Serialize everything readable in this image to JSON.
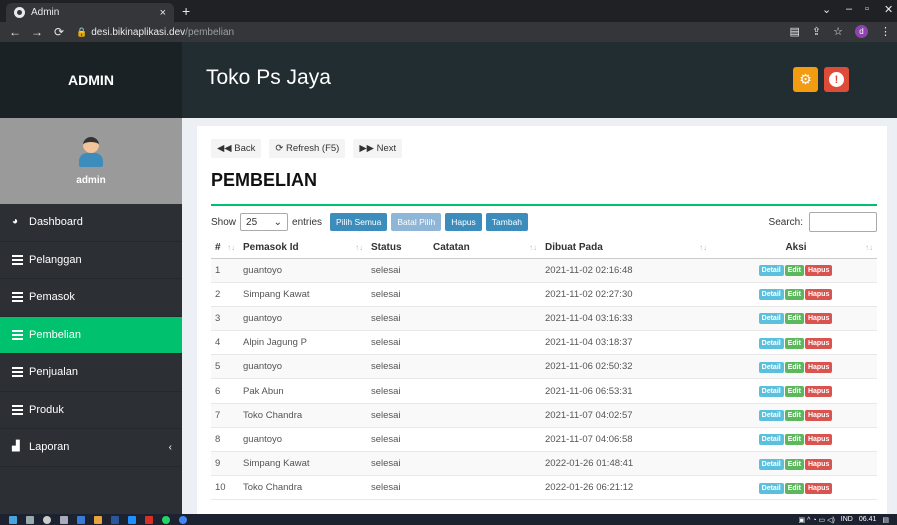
{
  "browser": {
    "tab_title": "Admin",
    "tab_close": "×",
    "new_tab": "+",
    "url_domain": "desi.bikinaplikasi.dev",
    "url_path": "/pembelian"
  },
  "header": {
    "logo": "ADMIN",
    "title": "Toko Ps Jaya"
  },
  "sidebar": {
    "user_name": "admin",
    "items": [
      {
        "label": "Dashboard",
        "icon": "dashboard-icon"
      },
      {
        "label": "Pelanggan",
        "icon": "table-icon"
      },
      {
        "label": "Pemasok",
        "icon": "table-icon"
      },
      {
        "label": "Pembelian",
        "icon": "table-icon",
        "active": true
      },
      {
        "label": "Penjualan",
        "icon": "table-icon"
      },
      {
        "label": "Produk",
        "icon": "table-icon"
      },
      {
        "label": "Laporan",
        "icon": "chart-icon"
      }
    ]
  },
  "toolbar": {
    "back": "Back",
    "refresh": "Refresh (F5)",
    "next": "Next"
  },
  "page_title": "PEMBELIAN",
  "controls": {
    "show_label": "Show",
    "entries_value": "25",
    "entries_label": "entries",
    "pilih_semua": "Pilih Semua",
    "batal_pilih": "Batal Pilih",
    "hapus": "Hapus",
    "tambah": "Tambah",
    "search_label": "Search:"
  },
  "table": {
    "headers": [
      "#",
      "Pemasok Id",
      "Status",
      "Catatan",
      "Dibuat Pada",
      "Aksi"
    ],
    "action_labels": {
      "detail": "Detail",
      "edit": "Edit",
      "hapus": "Hapus"
    },
    "rows": [
      {
        "no": "1",
        "pemasok": "guantoyo",
        "status": "selesai",
        "catatan": "",
        "dibuat": "2021-11-02 02:16:48"
      },
      {
        "no": "2",
        "pemasok": "Simpang Kawat",
        "status": "selesai",
        "catatan": "",
        "dibuat": "2021-11-02 02:27:30"
      },
      {
        "no": "3",
        "pemasok": "guantoyo",
        "status": "selesai",
        "catatan": "",
        "dibuat": "2021-11-04 03:16:33"
      },
      {
        "no": "4",
        "pemasok": "Alpin Jagung P",
        "status": "selesai",
        "catatan": "",
        "dibuat": "2021-11-04 03:18:37"
      },
      {
        "no": "5",
        "pemasok": "guantoyo",
        "status": "selesai",
        "catatan": "",
        "dibuat": "2021-11-06 02:50:32"
      },
      {
        "no": "6",
        "pemasok": "Pak Abun",
        "status": "selesai",
        "catatan": "",
        "dibuat": "2021-11-06 06:53:31"
      },
      {
        "no": "7",
        "pemasok": "Toko Chandra",
        "status": "selesai",
        "catatan": "",
        "dibuat": "2021-11-07 04:02:57"
      },
      {
        "no": "8",
        "pemasok": "guantoyo",
        "status": "selesai",
        "catatan": "",
        "dibuat": "2021-11-07 04:06:58"
      },
      {
        "no": "9",
        "pemasok": "Simpang Kawat",
        "status": "selesai",
        "catatan": "",
        "dibuat": "2022-01-26 01:48:41"
      },
      {
        "no": "10",
        "pemasok": "Toko Chandra",
        "status": "selesai",
        "catatan": "",
        "dibuat": "2022-01-26 06:21:12"
      }
    ]
  },
  "taskbar": {
    "lang": "IND",
    "time": "06.41"
  },
  "colors": {
    "accent_green": "#00c16e",
    "header_dark": "#222d32",
    "settings_orange": "#f39c12",
    "alert_red": "#dd4b39"
  }
}
